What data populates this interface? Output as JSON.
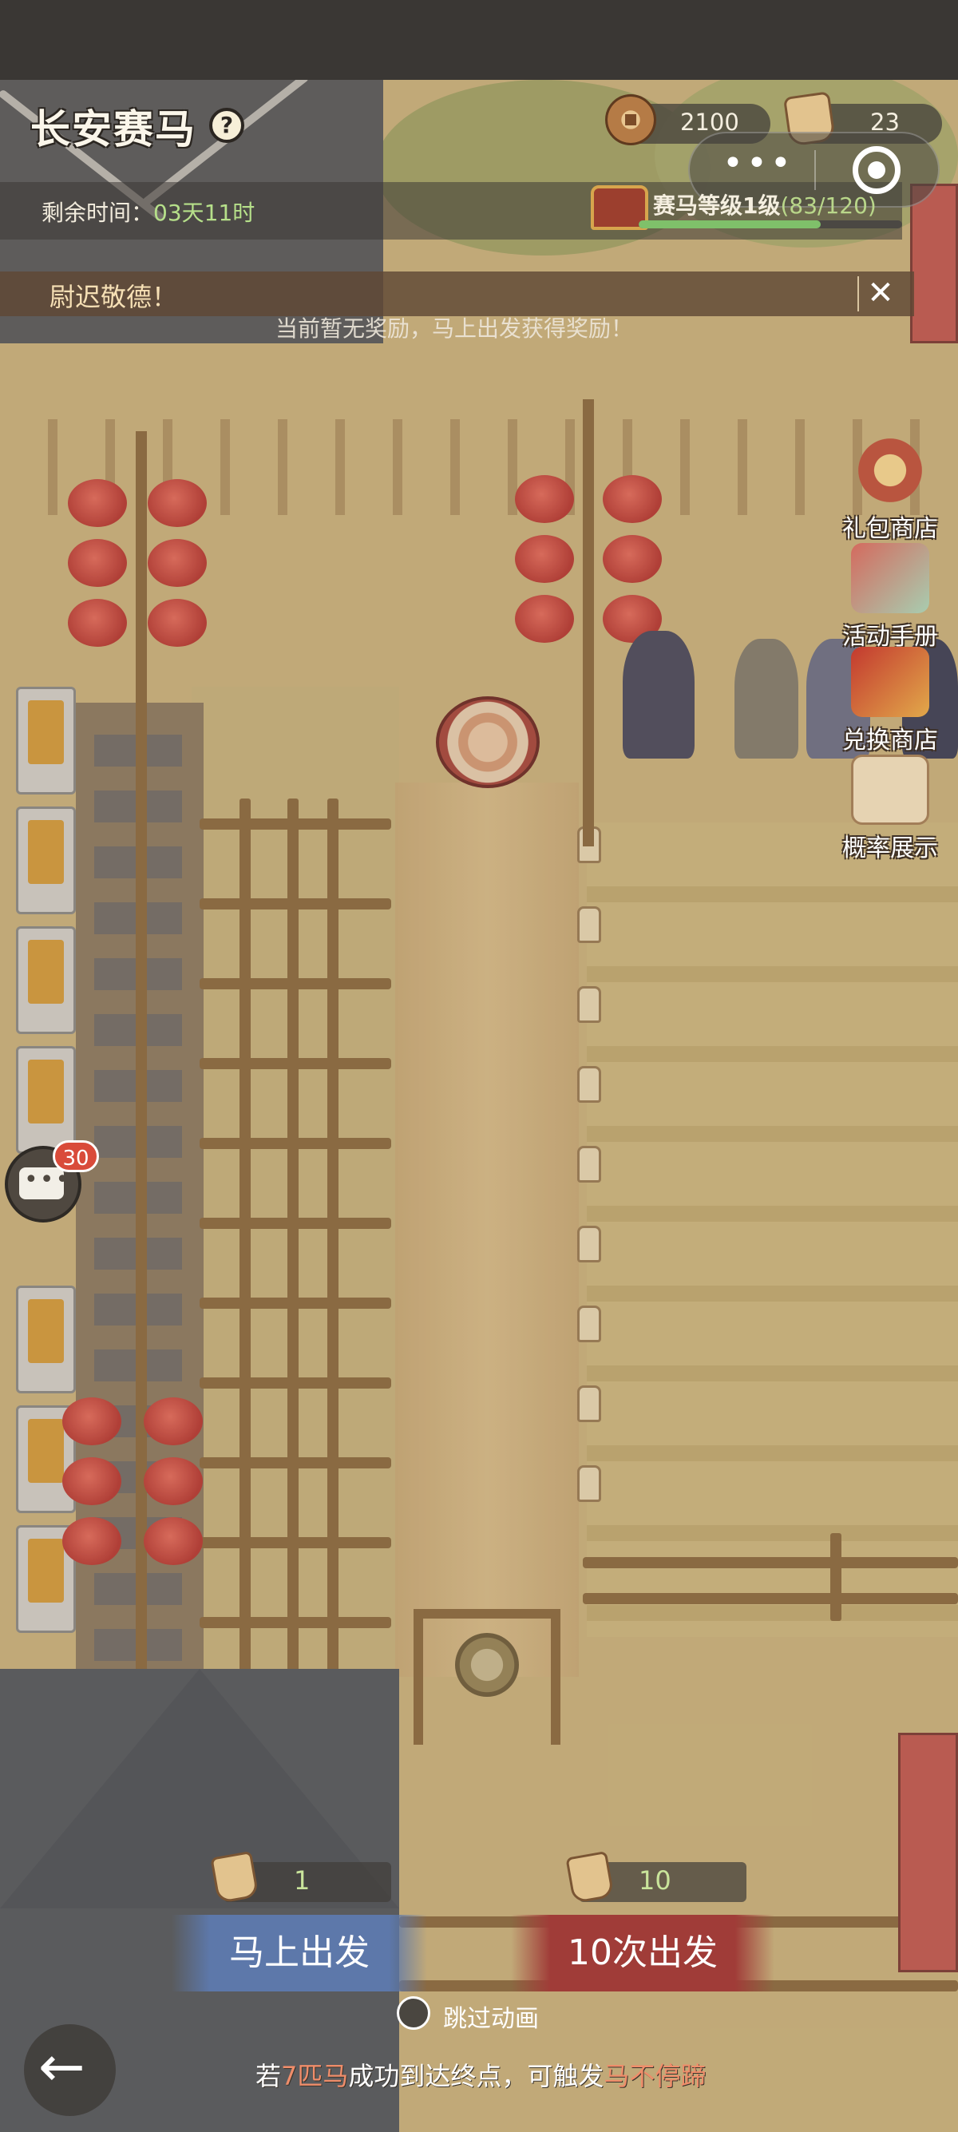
{
  "header": {
    "title": "长安赛马",
    "help_icon": "question-circle-icon",
    "remaining_label": "剩余时间：",
    "remaining_value": "03天11时"
  },
  "currencies": {
    "coins": "2100",
    "tickets": "23"
  },
  "level": {
    "label": "赛马等级1级",
    "progress_text": "(83/120)",
    "progress": 0.69
  },
  "notice": {
    "text": "尉迟敬德！",
    "close": "✕",
    "reward_hint": "当前暂无奖励，马上出发获得奖励！"
  },
  "side_menu": [
    {
      "label": "礼包商店",
      "icon": "gift-shop-icon"
    },
    {
      "label": "活动手册",
      "icon": "handbook-icon"
    },
    {
      "label": "兑换商店",
      "icon": "exchange-shop-icon"
    },
    {
      "label": "概率展示",
      "icon": "probability-scroll-icon"
    }
  ],
  "chat": {
    "badge": "30",
    "icon": "chat-bubble-icon"
  },
  "actions": {
    "single": {
      "cost": "1",
      "label": "马上出发"
    },
    "ten": {
      "cost": "10",
      "label": "10次出发"
    },
    "skip_label": "跳过动画"
  },
  "footer": {
    "hint_prefix": "若",
    "hint_highlight1": "7匹马",
    "hint_middle": "成功到达终点，可触发",
    "hint_highlight2": "马不停蹄"
  },
  "colors": {
    "accent_green": "#b6e08a",
    "button_blue": "#5d78aa",
    "button_red": "#a03c38",
    "badge_red": "#d94b3a"
  }
}
